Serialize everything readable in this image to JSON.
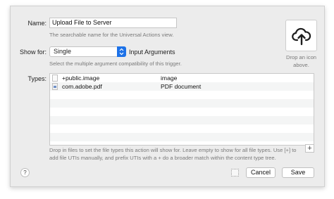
{
  "form": {
    "name_label": "Name:",
    "name_value": "Upload File to Server",
    "name_help": "The searchable name for the Universal Actions view.",
    "show_for_label": "Show for:",
    "show_for_value": "Single",
    "show_for_suffix": "Input Arguments",
    "show_for_help": "Select the multiple argument compatibility of this trigger.",
    "types_label": "Types:",
    "types_help": "Drop in files to set the file types this action will show for. Leave empty to show for all file types. Use [+] to add file UTIs manually, and prefix UTIs with a + do a broader match within the content type tree."
  },
  "icon_well": {
    "icon": "cloud-upload-icon",
    "caption": "Drop an icon above."
  },
  "types": [
    {
      "uti": "+public.image",
      "description": "image",
      "icon": "file-icon"
    },
    {
      "uti": "com.adobe.pdf",
      "description": "PDF document",
      "icon": "pdf-file-icon"
    }
  ],
  "buttons": {
    "add": "+",
    "help": "?",
    "cancel": "Cancel",
    "save": "Save"
  }
}
